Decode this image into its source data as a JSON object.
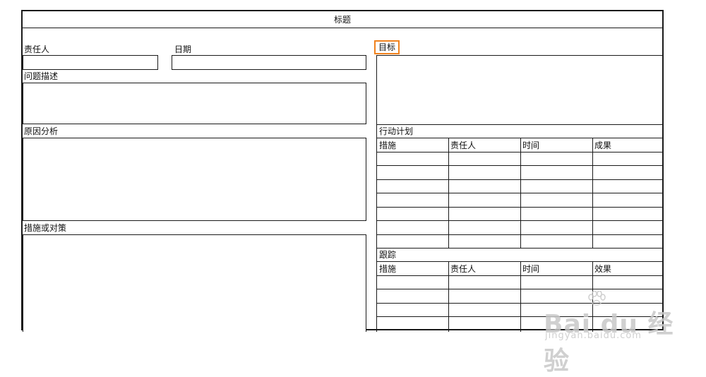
{
  "title": "标题",
  "left": {
    "owner_label": "责任人",
    "date_label": "日期",
    "problem_label": "问题描述",
    "cause_label": "原因分析",
    "measures_label": "措施或对策"
  },
  "right": {
    "goal_label": "目标",
    "action_plan": {
      "title": "行动计划",
      "headers": [
        "措施",
        "责任人",
        "时间",
        "成果"
      ]
    },
    "tracking": {
      "title": "跟踪",
      "headers": [
        "措施",
        "责任人",
        "时间",
        "效果"
      ]
    }
  },
  "colors": {
    "border": "#1a1a1a",
    "highlight": "#f0821e",
    "watermark": "#c8c8c8"
  }
}
